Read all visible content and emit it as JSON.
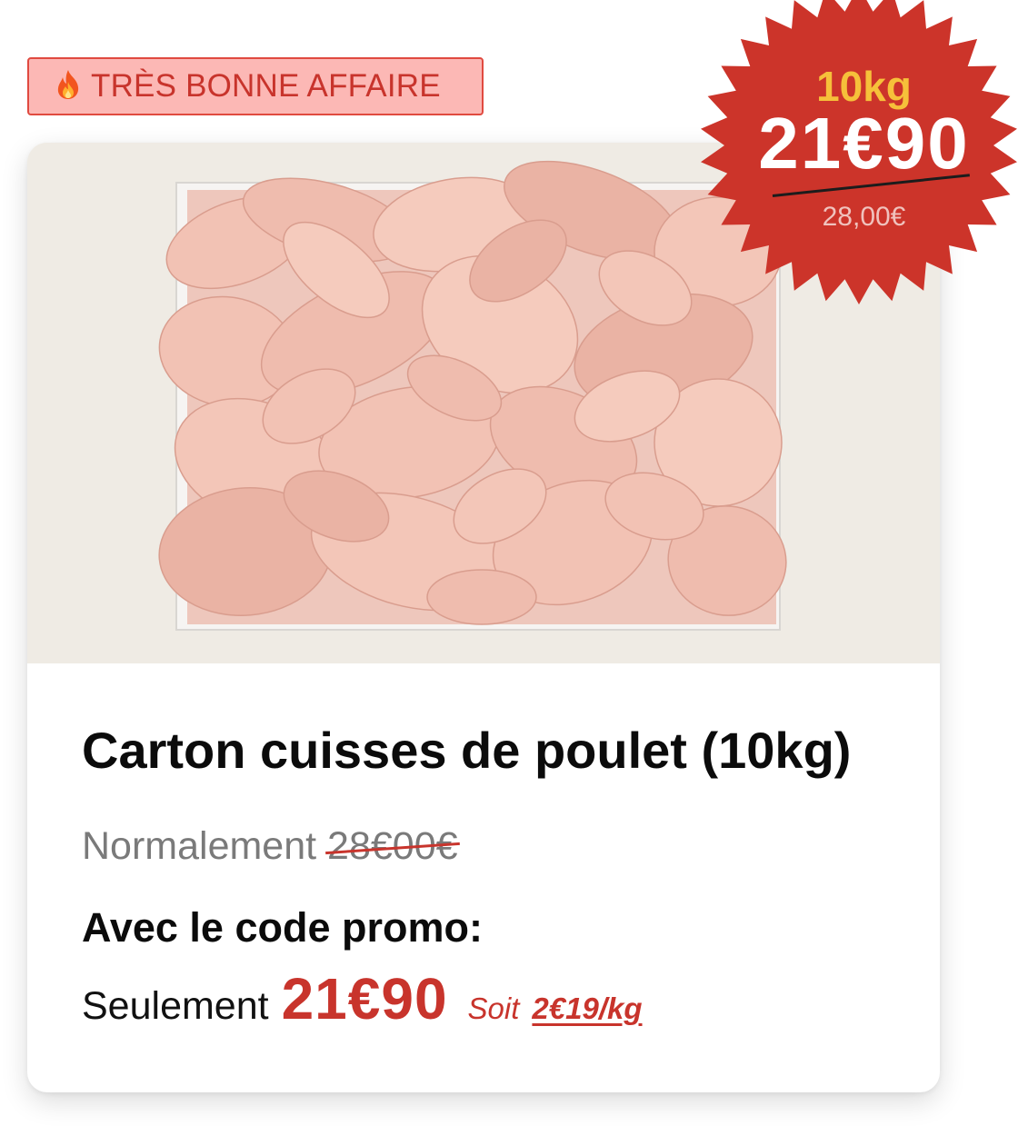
{
  "badge": {
    "icon": "fire-icon",
    "label": "TRÈS BONNE AFFAIRE"
  },
  "starburst": {
    "weight": "10kg",
    "price": "21€90",
    "old_price": "28,00€"
  },
  "product": {
    "image": "chicken-legs-box",
    "title": "Carton cuisses de poulet (10kg)",
    "normal_label": "Normalement",
    "normal_price": "28€00€",
    "promo_label": "Avec le code promo:",
    "only_label": "Seulement",
    "only_price": "21€90",
    "soit_label": "Soit",
    "per_kg": "2€19/kg"
  },
  "colors": {
    "accent_red": "#c8342c",
    "badge_bg": "#fcb8b5",
    "star_bg": "#cc342a",
    "star_weight": "#f6c03a",
    "image_bg": "#efebe4"
  }
}
